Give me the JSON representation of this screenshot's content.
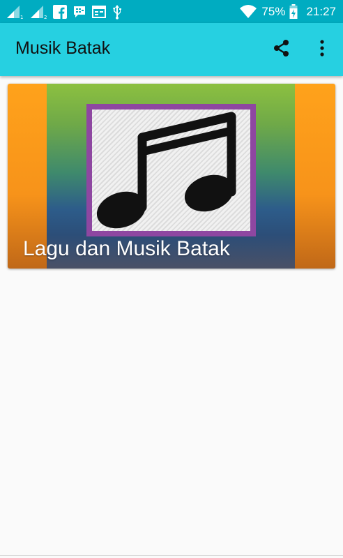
{
  "status_bar": {
    "battery_percent": "75%",
    "time": "21:27",
    "icons": [
      "signal-sim1-icon",
      "signal-sim2-icon",
      "facebook-icon",
      "messenger-icon",
      "calendar-icon",
      "usb-icon",
      "wifi-icon",
      "battery-charging-icon"
    ]
  },
  "app_bar": {
    "title": "Musik Batak",
    "actions": [
      "share-icon",
      "more-vert-icon"
    ]
  },
  "card": {
    "title": "Lagu dan Musik Batak",
    "image_icon": "music-note-icon"
  },
  "colors": {
    "status_bar": "#00acc1",
    "app_bar": "#26d0e1",
    "card_orange": "#f7931a",
    "frame_purple": "#8e47a1",
    "background": "#fafafa"
  }
}
